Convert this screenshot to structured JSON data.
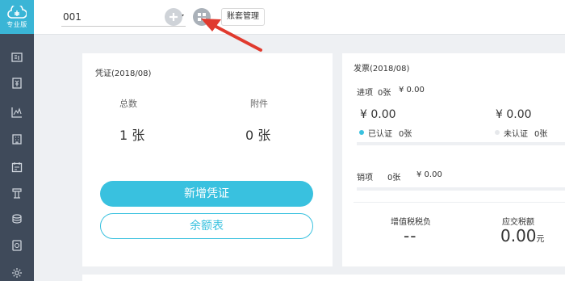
{
  "sidebar": {
    "logo_text": "专业版",
    "items": [
      {
        "icon": "ledger-icon"
      },
      {
        "icon": "voucher-icon"
      },
      {
        "icon": "chart-icon"
      },
      {
        "icon": "building-icon"
      },
      {
        "icon": "calendar-icon"
      },
      {
        "icon": "tax-icon"
      },
      {
        "icon": "coins-icon"
      },
      {
        "icon": "report-icon"
      },
      {
        "icon": "gear-icon"
      }
    ]
  },
  "topbar": {
    "account_value": "001",
    "tooltip": "账套管理"
  },
  "voucher": {
    "title": "凭证(2018/08)",
    "total_label": "总数",
    "attach_label": "附件",
    "total_value": "1 张",
    "attach_value": "0 张",
    "new_button": "新增凭证",
    "balance_button": "余额表"
  },
  "invoice": {
    "title": "发票(2018/08)",
    "input_label": "进项",
    "input_count": "0张",
    "input_amount": "¥ 0.00",
    "certified_amount": "¥ 0.00",
    "uncertified_amount": "¥ 0.00",
    "certified_label": "已认证",
    "certified_count": "0张",
    "uncertified_label": "未认证",
    "uncertified_count": "0张",
    "output_label": "销项",
    "output_count": "0张",
    "output_amount": "¥ 0.00",
    "vat_label": "增值税税负",
    "vat_value": "--",
    "tax_label": "应交税额",
    "tax_value": "0.00",
    "tax_unit": "元"
  },
  "colors": {
    "accent": "#39c1df",
    "sidebar": "#3f4a5a",
    "arrow": "#e03a2e"
  }
}
